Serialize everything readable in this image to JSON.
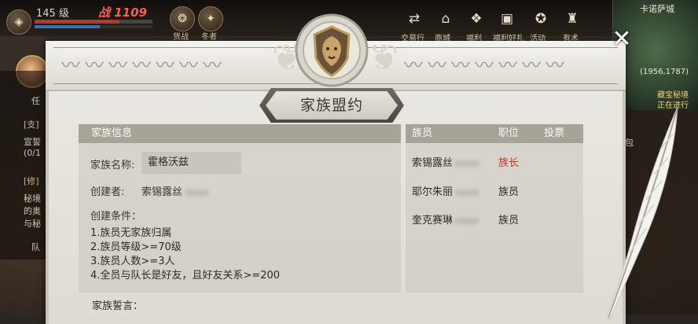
{
  "hud": {
    "level": "145 级",
    "power": "战 1109",
    "top_buttons": [
      {
        "label": "货战",
        "icon": "rank-medal-icon"
      },
      {
        "label": "冬者",
        "icon": "wolf-emblem-icon"
      }
    ],
    "menu": [
      {
        "label": "交易行",
        "icon": "trade-icon"
      },
      {
        "label": "商城",
        "icon": "mall-icon"
      },
      {
        "label": "福利",
        "icon": "gift-icon"
      },
      {
        "label": "福利好礼",
        "icon": "giftbox-icon"
      },
      {
        "label": "活动",
        "icon": "event-icon"
      },
      {
        "label": "有术",
        "icon": "skill-icon"
      }
    ],
    "map": {
      "zone": "卡诺萨城",
      "coords": "(1956,1787)",
      "quest_lines": [
        "藏宝秘境",
        "正在进行"
      ]
    },
    "left_panel": {
      "tab1": "[支]",
      "line1": "宣誓",
      "line2": "(0/1",
      "tab2": "[修]",
      "line3": "秘境",
      "line4": "的奥",
      "line5": "与秘",
      "team": "队"
    },
    "side_label": "任",
    "right_panel": {
      "bag": "包"
    }
  },
  "dialog": {
    "title": "家族盟约",
    "info": {
      "header": "家族信息",
      "name_label": "家族名称:",
      "name_value": "霍格沃兹",
      "creator_label": "创建者:",
      "creator_value": "索锡露丝",
      "conditions_label": "创建条件：",
      "conditions": [
        "1.族员无家族归属",
        "2.族员等级>=70级",
        "3.族员人数>=3人",
        "4.全员与队长是好友，且好友关系>=200"
      ],
      "oath_label": "家族誓言："
    },
    "members": {
      "headers": [
        "族员",
        "职位",
        "投票"
      ],
      "rows": [
        {
          "name": "索锡露丝",
          "role": "族长",
          "is_leader": true
        },
        {
          "name": "耶尔朱丽",
          "role": "族员",
          "is_leader": false
        },
        {
          "name": "奎克赛琳",
          "role": "族员",
          "is_leader": false
        }
      ]
    },
    "close_icon": "close-icon"
  },
  "colors": {
    "parchment": "#e6e4dd",
    "panel_header": "#a8a398",
    "leader_role": "#c8392c",
    "power_text": "#ff5a4a"
  }
}
